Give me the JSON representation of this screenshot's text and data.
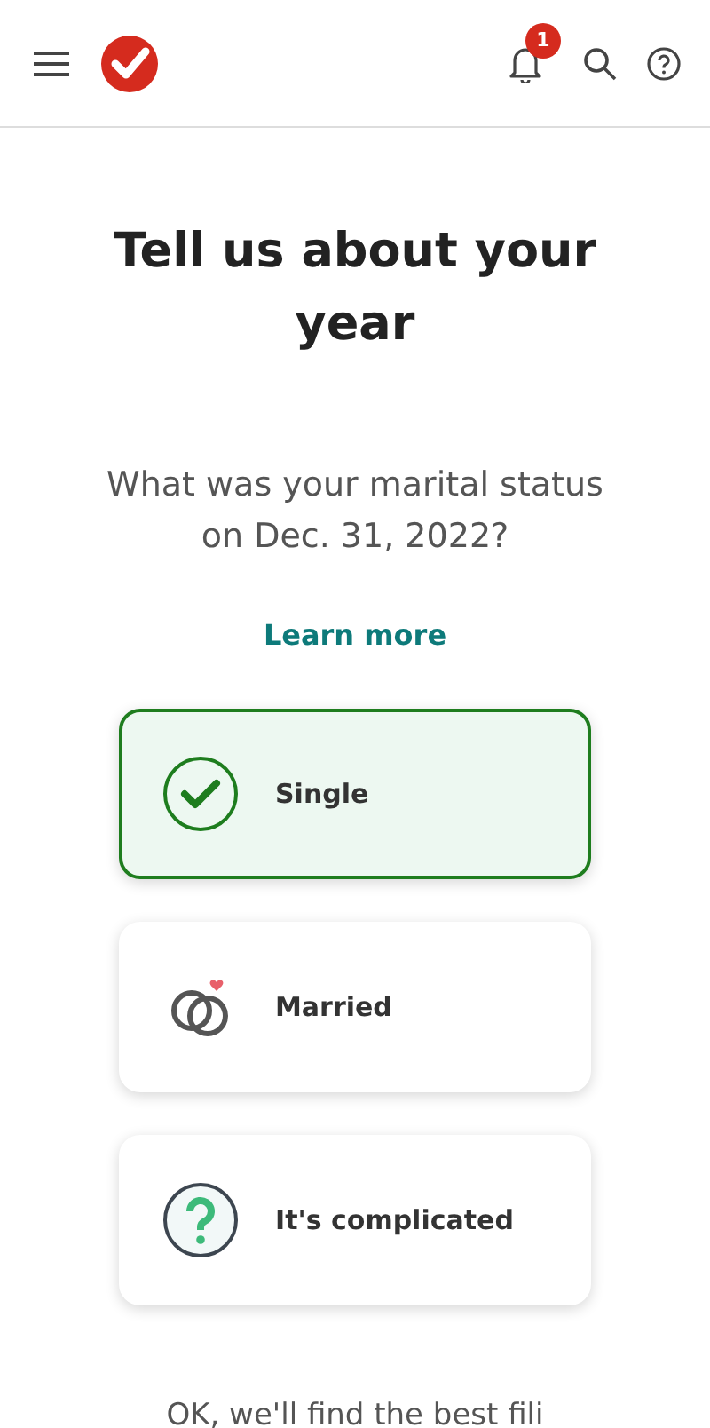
{
  "header": {
    "notification_count": "1"
  },
  "title": "Tell us about your year",
  "question": "What was your marital status on Dec. 31, 2022?",
  "link": "Learn more",
  "options": [
    {
      "label": "Single",
      "kind": "check",
      "selected": true
    },
    {
      "label": "Married",
      "kind": "rings",
      "selected": false
    },
    {
      "label": "It's complicated",
      "kind": "question",
      "selected": false
    }
  ],
  "footer_text": "OK, we'll find the best fili"
}
